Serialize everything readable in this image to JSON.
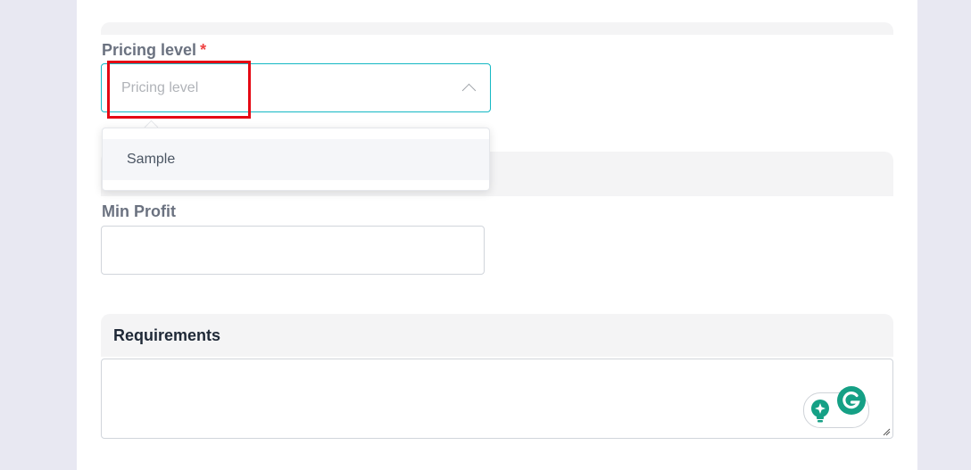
{
  "form": {
    "pricing_level": {
      "label": "Pricing level",
      "required_mark": "*",
      "placeholder": "Pricing level",
      "options": [
        "Sample"
      ]
    },
    "min_profit": {
      "label": "Min Profit",
      "value": ""
    },
    "requirements": {
      "title": "Requirements",
      "value": ""
    }
  },
  "colors": {
    "accent": "#14b8c4",
    "highlight": "#e50914",
    "required": "#ef4444",
    "grammarly": "#15a085"
  },
  "icons": {
    "select_toggle": "chevron-up-icon",
    "grammarly": "grammarly-icon",
    "assist": "lightbulb-icon"
  }
}
